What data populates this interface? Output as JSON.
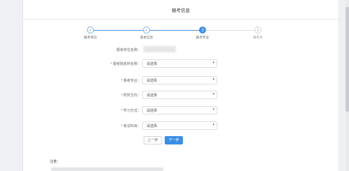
{
  "header": {
    "title": "报考信息"
  },
  "steps": [
    {
      "label": "报考单位",
      "state": "done",
      "mark": "✓"
    },
    {
      "label": "基本信息",
      "state": "done",
      "mark": "✓"
    },
    {
      "label": "报考专业",
      "state": "active",
      "mark": "3"
    },
    {
      "label": "报考点",
      "state": "todo",
      "mark": "4"
    }
  ],
  "form": {
    "unit_name_label": "报考单位名称：",
    "fields": [
      {
        "label": "报考院系所名称：",
        "value": "请选择"
      },
      {
        "label": "报考专业：",
        "value": "请选择"
      },
      {
        "label": "研究方向：",
        "value": "请选择"
      },
      {
        "label": "学习方式：",
        "value": "请选择"
      },
      {
        "label": "考试科目：",
        "value": "请选择"
      }
    ],
    "required_mark": "*"
  },
  "buttons": {
    "prev": "上一步",
    "next": "下一步"
  },
  "notes": {
    "title": "注意："
  },
  "colors": {
    "accent": "#3a8ee6",
    "required": "#e8613c"
  }
}
